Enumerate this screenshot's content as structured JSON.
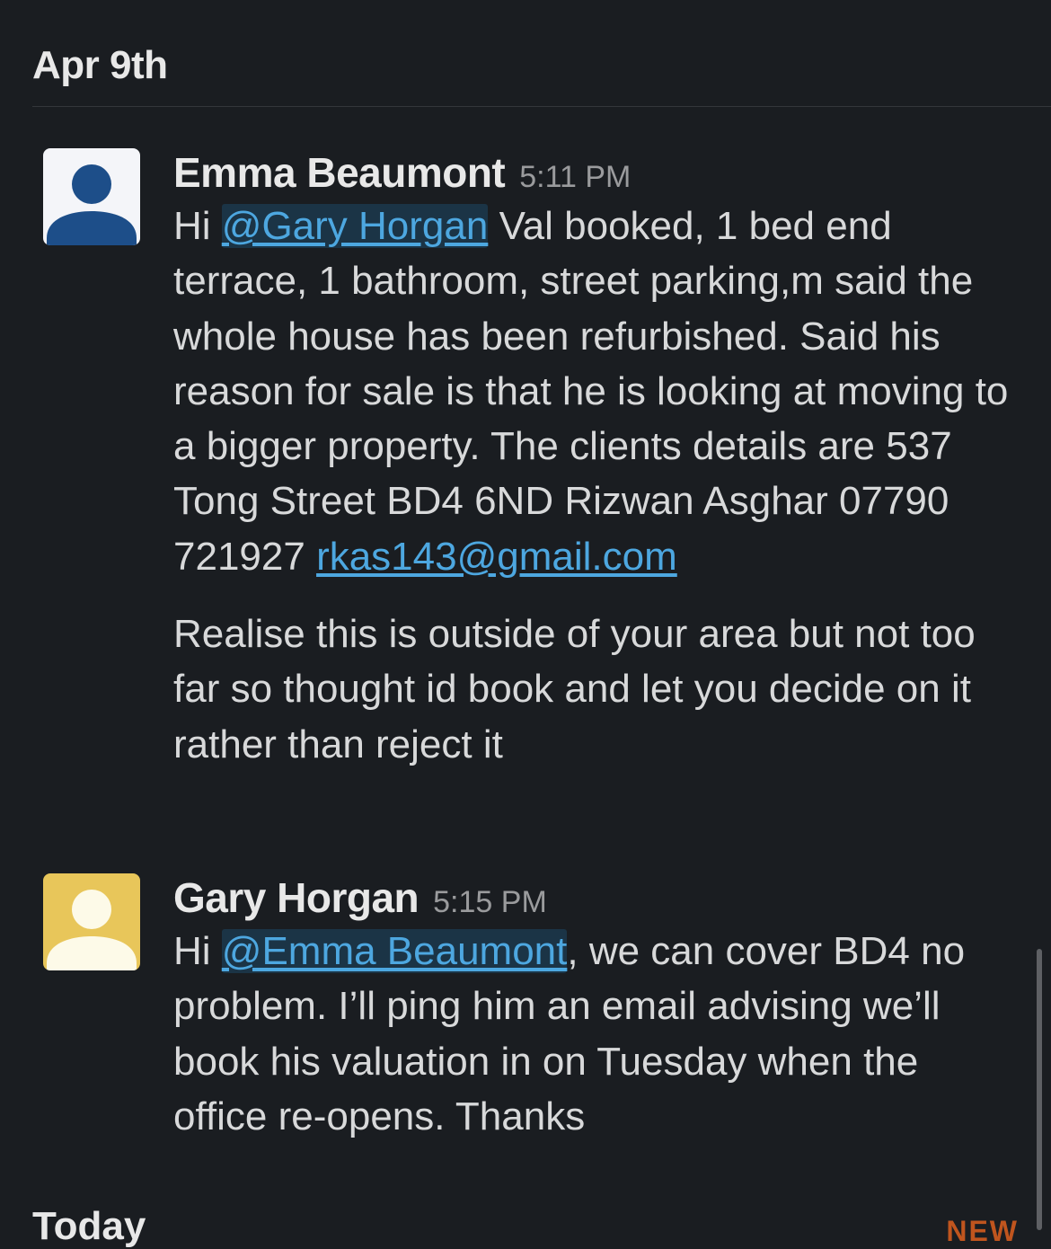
{
  "date_header": "Apr 9th",
  "messages": [
    {
      "author": "Emma Beaumont",
      "time": "5:11 PM",
      "avatar_color": "#f4f5f9",
      "avatar_figure_color": "#1d4e89",
      "p1_pre": "Hi ",
      "p1_mention": "@Gary Horgan",
      "p1_mid": " Val booked, 1 bed end terrace, 1 bathroom, street parking,m said the whole house has been refurbished. Said his reason for sale is that he is looking at moving to a bigger property. The clients details are 537 Tong Street BD4 6ND Rizwan Asghar 07790 721927 ",
      "p1_link": "rkas143@gmail.com",
      "p2": "Realise this is outside of your area but not too far so thought id book and let you decide on it rather than reject it"
    },
    {
      "author": "Gary Horgan",
      "time": "5:15 PM",
      "avatar_color": "#e8c65a",
      "avatar_figure_color": "#fdfae8",
      "p1_pre": "Hi ",
      "p1_mention": "@Emma Beaumont",
      "p1_post": ", we can cover BD4 no problem. I’ll ping him an email advising we’ll book his valuation in on Tuesday when the office re-opens. Thanks"
    }
  ],
  "today_header": "Today",
  "new_label": "NEW",
  "colors": {
    "background": "#1a1d21",
    "link": "#4da7e0",
    "new_marker": "#c0551e"
  }
}
